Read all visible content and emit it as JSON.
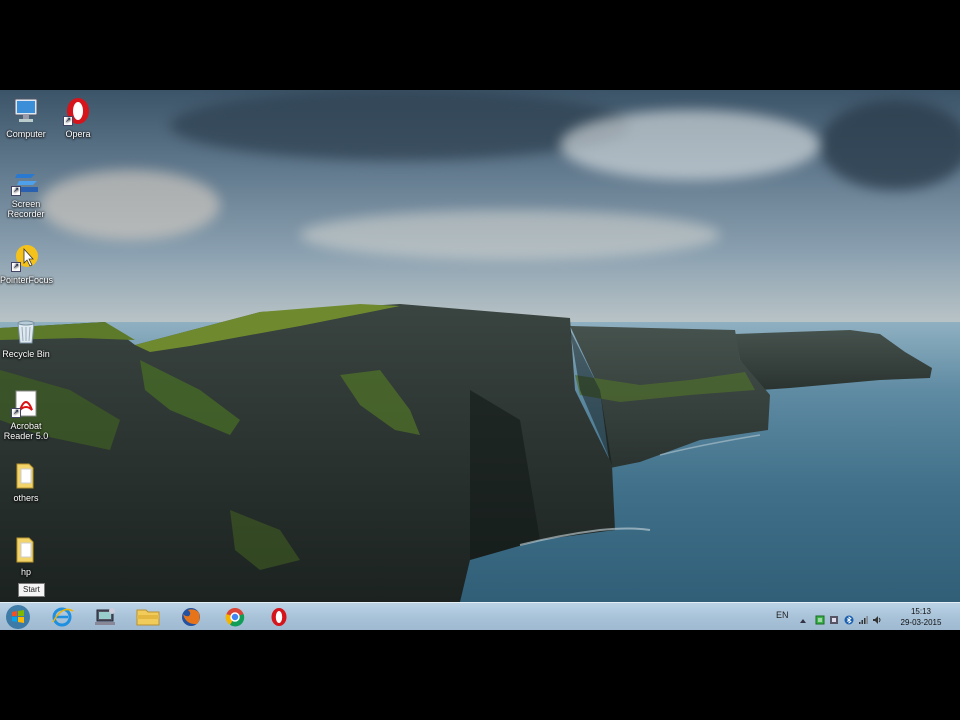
{
  "desktop": {
    "icons": [
      {
        "label": "Computer"
      },
      {
        "label": "Opera"
      },
      {
        "label": "Screen Recorder"
      },
      {
        "label": "PointerFocus"
      },
      {
        "label": "Recycle Bin"
      },
      {
        "label": "Acrobat Reader 5.0"
      },
      {
        "label": "others"
      },
      {
        "label": "hp"
      }
    ],
    "tooltip": "Start"
  },
  "taskbar": {
    "pinned": [
      "internet-explorer",
      "network-computer",
      "file-explorer",
      "firefox",
      "chrome",
      "opera"
    ],
    "tray": {
      "language": "EN",
      "time": "15:13",
      "date": "29-03-2015"
    }
  }
}
